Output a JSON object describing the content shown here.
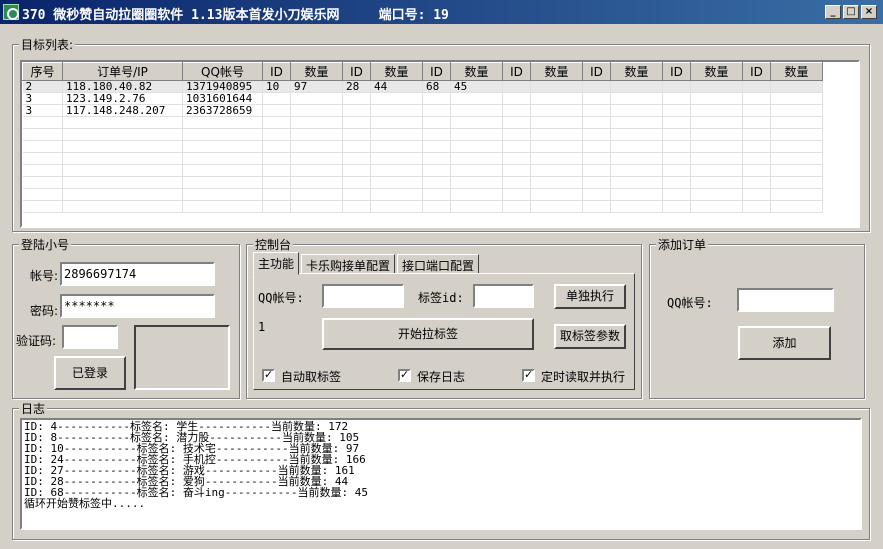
{
  "window": {
    "title": "370 微秒赞自动拉圈圈软件 1.13版本首发小刀娱乐网     端口号: 19",
    "min": "_",
    "max": "□",
    "close": "×"
  },
  "targets": {
    "label": "目标列表:",
    "columns": [
      "序号",
      "订单号/IP",
      "QQ帐号",
      "ID",
      "数量",
      "ID",
      "数量",
      "ID",
      "数量",
      "ID",
      "数量",
      "ID",
      "数量",
      "ID",
      "数量",
      "ID",
      "数量"
    ],
    "rows": [
      [
        "2",
        "118.180.40.82",
        "1371940895",
        "10",
        "97",
        "28",
        "44",
        "68",
        "45",
        "",
        "",
        "",
        "",
        "",
        "",
        "",
        ""
      ],
      [
        "3",
        "123.149.2.76",
        "1031601644",
        "",
        "",
        "",
        "",
        "",
        "",
        "",
        "",
        "",
        "",
        "",
        "",
        "",
        ""
      ],
      [
        "3",
        "117.148.248.207",
        "2363728659",
        "",
        "",
        "",
        "",
        "",
        "",
        "",
        "",
        "",
        "",
        "",
        "",
        "",
        ""
      ]
    ]
  },
  "login": {
    "label": "登陆小号",
    "account_label": "帐号:",
    "account_value": "2896697174",
    "password_label": "密码:",
    "password_value": "*******",
    "captcha_label": "验证码:",
    "captcha_value": "",
    "login_button": "已登录"
  },
  "control": {
    "label": "控制台",
    "tabs": [
      "主功能",
      "卡乐购接单配置",
      "接口端口配置"
    ],
    "qq_label": "QQ帐号:",
    "qq_value": "",
    "tagid_label": "标签id:",
    "tagid_value": "",
    "single_exec": "单独执行",
    "counter": "1",
    "start_button": "开始拉标签",
    "get_tag_params": "取标签参数",
    "auto_tag": "自动取标签",
    "save_log": "保存日志",
    "timed_read": "定时读取并执行"
  },
  "add_order": {
    "label": "添加订单",
    "qq_label": "QQ帐号:",
    "qq_value": "",
    "add_button": "添加"
  },
  "log": {
    "label": "日志",
    "lines": [
      "ID: 4-----------标签名: 学生-----------当前数量: 172",
      "ID: 8-----------标签名: 潜力股-----------当前数量: 105",
      "ID: 10-----------标签名: 技术宅-----------当前数量: 97",
      "ID: 24-----------标签名: 手机控-----------当前数量: 166",
      "ID: 27-----------标签名: 游戏-----------当前数量: 161",
      "ID: 28-----------标签名: 爱狗-----------当前数量: 44",
      "ID: 68-----------标签名: 奋斗ing-----------当前数量: 45",
      "循环开始赞标签中....."
    ]
  }
}
